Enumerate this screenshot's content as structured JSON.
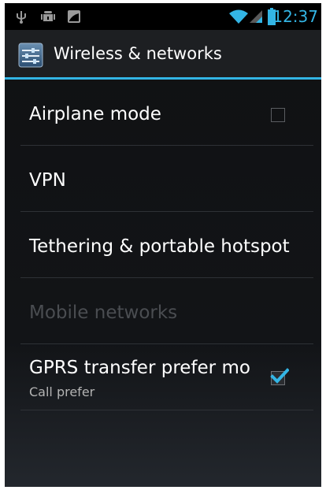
{
  "status_bar": {
    "time": "12:37",
    "icons": [
      "usb-icon",
      "android-debug-icon",
      "image-notification-icon",
      "wifi-icon",
      "signal-icon",
      "battery-icon"
    ]
  },
  "action_bar": {
    "title": "Wireless & networks",
    "icon": "settings-icon"
  },
  "items": [
    {
      "title": "Airplane mode",
      "enabled": true,
      "checkbox": true,
      "checked": false
    },
    {
      "title": "VPN",
      "enabled": true
    },
    {
      "title": "Tethering & portable hotspot",
      "enabled": true
    },
    {
      "title": "Mobile networks",
      "enabled": false
    },
    {
      "title": "GPRS transfer prefer mode",
      "subtitle": "Call prefer",
      "enabled": true,
      "checkbox": true,
      "checked": true
    }
  ],
  "colors": {
    "accent": "#33b5e5",
    "background": "#121417",
    "disabled_text": "#4a4d51"
  }
}
